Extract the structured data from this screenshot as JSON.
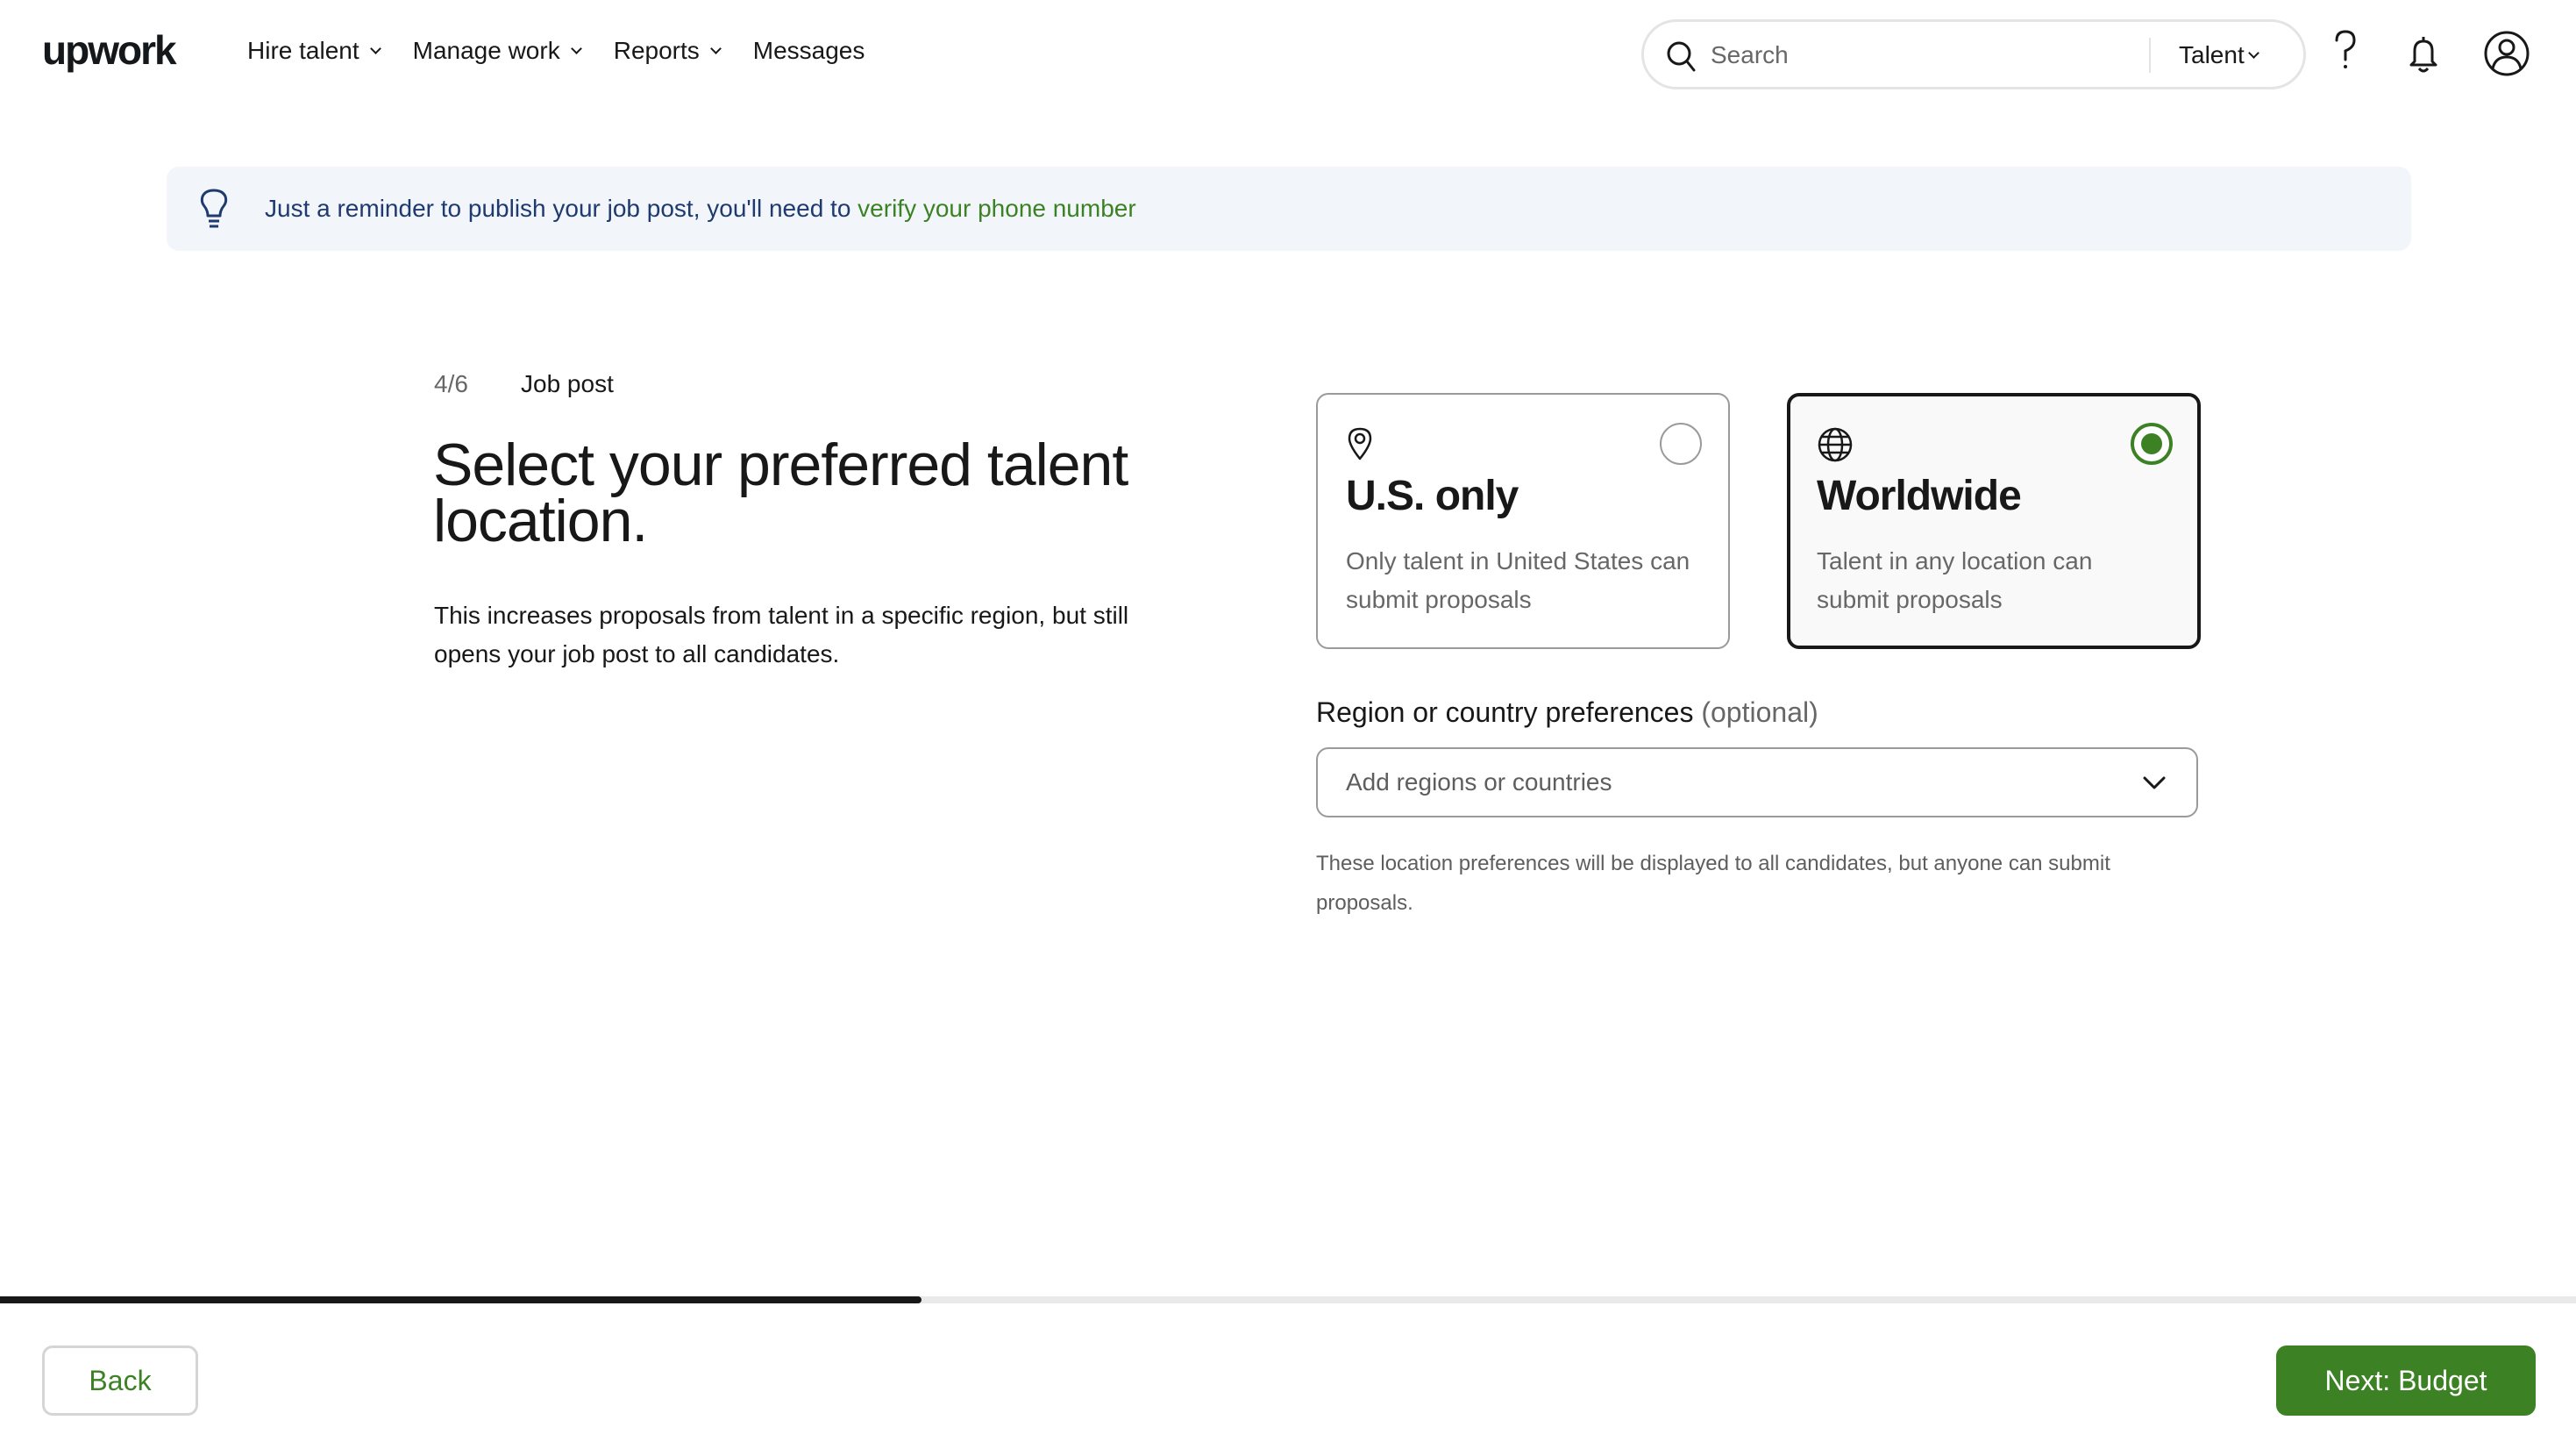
{
  "header": {
    "logo": "upwork",
    "nav": [
      {
        "label": "Hire talent",
        "has_dropdown": true
      },
      {
        "label": "Manage work",
        "has_dropdown": true
      },
      {
        "label": "Reports",
        "has_dropdown": true
      },
      {
        "label": "Messages",
        "has_dropdown": false
      }
    ],
    "search": {
      "placeholder": "Search",
      "value": "",
      "type_selected": "Talent"
    },
    "icons": [
      "help-icon",
      "notification-bell-icon",
      "user-avatar-icon"
    ]
  },
  "banner": {
    "icon": "lightbulb-icon",
    "text": "Just a reminder to publish your job post, you'll need to ",
    "link": "verify your phone number"
  },
  "step": {
    "counter": "4/6",
    "label": "Job post"
  },
  "main": {
    "title": "Select your preferred talent location.",
    "description": "This increases proposals from talent in a specific region, but still opens your job post to all candidates."
  },
  "options": [
    {
      "id": "us",
      "icon": "location-pin-icon",
      "title": "U.S. only",
      "description": "Only talent in United States can submit proposals",
      "selected": false
    },
    {
      "id": "worldwide",
      "icon": "globe-icon",
      "title": "Worldwide",
      "description": "Talent in any location can submit proposals",
      "selected": true
    }
  ],
  "region": {
    "label": "Region or country preferences",
    "optional": "(optional)",
    "placeholder": "Add regions or countries",
    "help": "These location preferences will be displayed to all candidates, but anyone can submit proposals."
  },
  "progress": {
    "current_step": 4,
    "total_steps": 6,
    "fraction": 0.67
  },
  "footer": {
    "back_label": "Back",
    "next_label": "Next: Budget"
  },
  "colors": {
    "accent_green": "#3c8224",
    "banner_bg": "#f2f6fb",
    "banner_text": "#1f3a6e",
    "text_dark": "#181818"
  }
}
